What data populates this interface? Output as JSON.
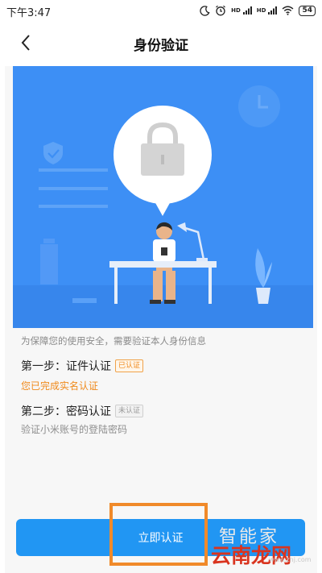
{
  "status_bar": {
    "time": "下午3:47",
    "battery": "54",
    "signal_label": "HD"
  },
  "nav": {
    "title": "身份验证"
  },
  "info_text": "为保障您的使用安全，需要验证本人身份信息",
  "steps": [
    {
      "title": "第一步：证件认证",
      "badge": "已认证",
      "subtitle": "您已完成实名认证",
      "status": "done"
    },
    {
      "title": "第二步：密码认证",
      "badge": "未认证",
      "subtitle": "验证小米账号的登陆密码",
      "status": "pending"
    }
  ],
  "primary_button": {
    "label": "立即认证"
  },
  "watermark": {
    "top": "智能家",
    "main": "云南龙网",
    "url": "www.znj.com"
  },
  "colors": {
    "hero_bg": "#3d8ff5",
    "primary": "#2196f3",
    "done_orange": "#f08a1c",
    "highlight": "#f08a2a"
  },
  "icons": [
    "back-arrow-icon",
    "lock-icon",
    "clock-icon",
    "shield-check-icon",
    "plant-icon",
    "desk-lamp-icon",
    "moon-icon",
    "alarm-icon",
    "wifi-icon",
    "battery-icon"
  ]
}
